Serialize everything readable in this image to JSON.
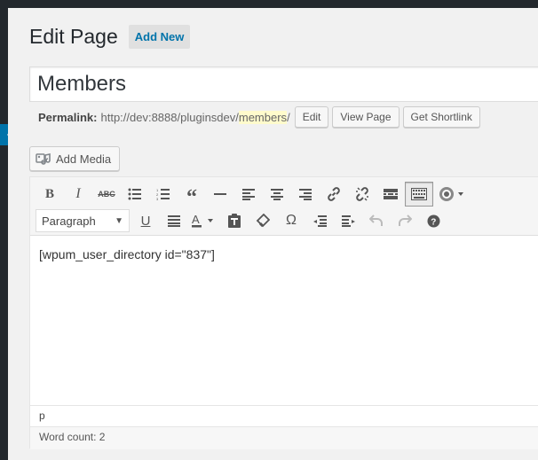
{
  "header": {
    "title": "Edit Page",
    "add_new_label": "Add New"
  },
  "post_title": "Members",
  "permalink": {
    "label": "Permalink:",
    "base_url": "http://dev:8888/pluginsdev/",
    "slug": "members",
    "trailing": "/",
    "edit_label": "Edit",
    "view_label": "View Page",
    "shortlink_label": "Get Shortlink"
  },
  "media": {
    "add_media_label": "Add Media"
  },
  "editor": {
    "toolbar_row1": [
      "bold-icon",
      "italic-icon",
      "strikethrough-icon",
      "bullet-list-icon",
      "numbered-list-icon",
      "blockquote-icon",
      "horizontal-line-icon",
      "align-left-icon",
      "align-center-icon",
      "align-right-icon",
      "insert-link-icon",
      "unlink-icon",
      "read-more-icon",
      "toolbar-toggle-icon",
      "wpum-shortcode-icon"
    ],
    "format_select_value": "Paragraph",
    "toolbar_row2": [
      "underline-icon",
      "justify-icon",
      "text-color-icon",
      "paste-as-text-icon",
      "clear-formatting-icon",
      "special-character-icon",
      "outdent-icon",
      "indent-icon",
      "undo-icon",
      "redo-icon",
      "help-icon"
    ],
    "content": "[wpum_user_directory id=\"837\"]",
    "path": "p",
    "word_count": "Word count: 2"
  },
  "colors": {
    "accent": "#0073aa",
    "admin_bar": "#23282d",
    "slug_highlight": "#fffbcc"
  }
}
